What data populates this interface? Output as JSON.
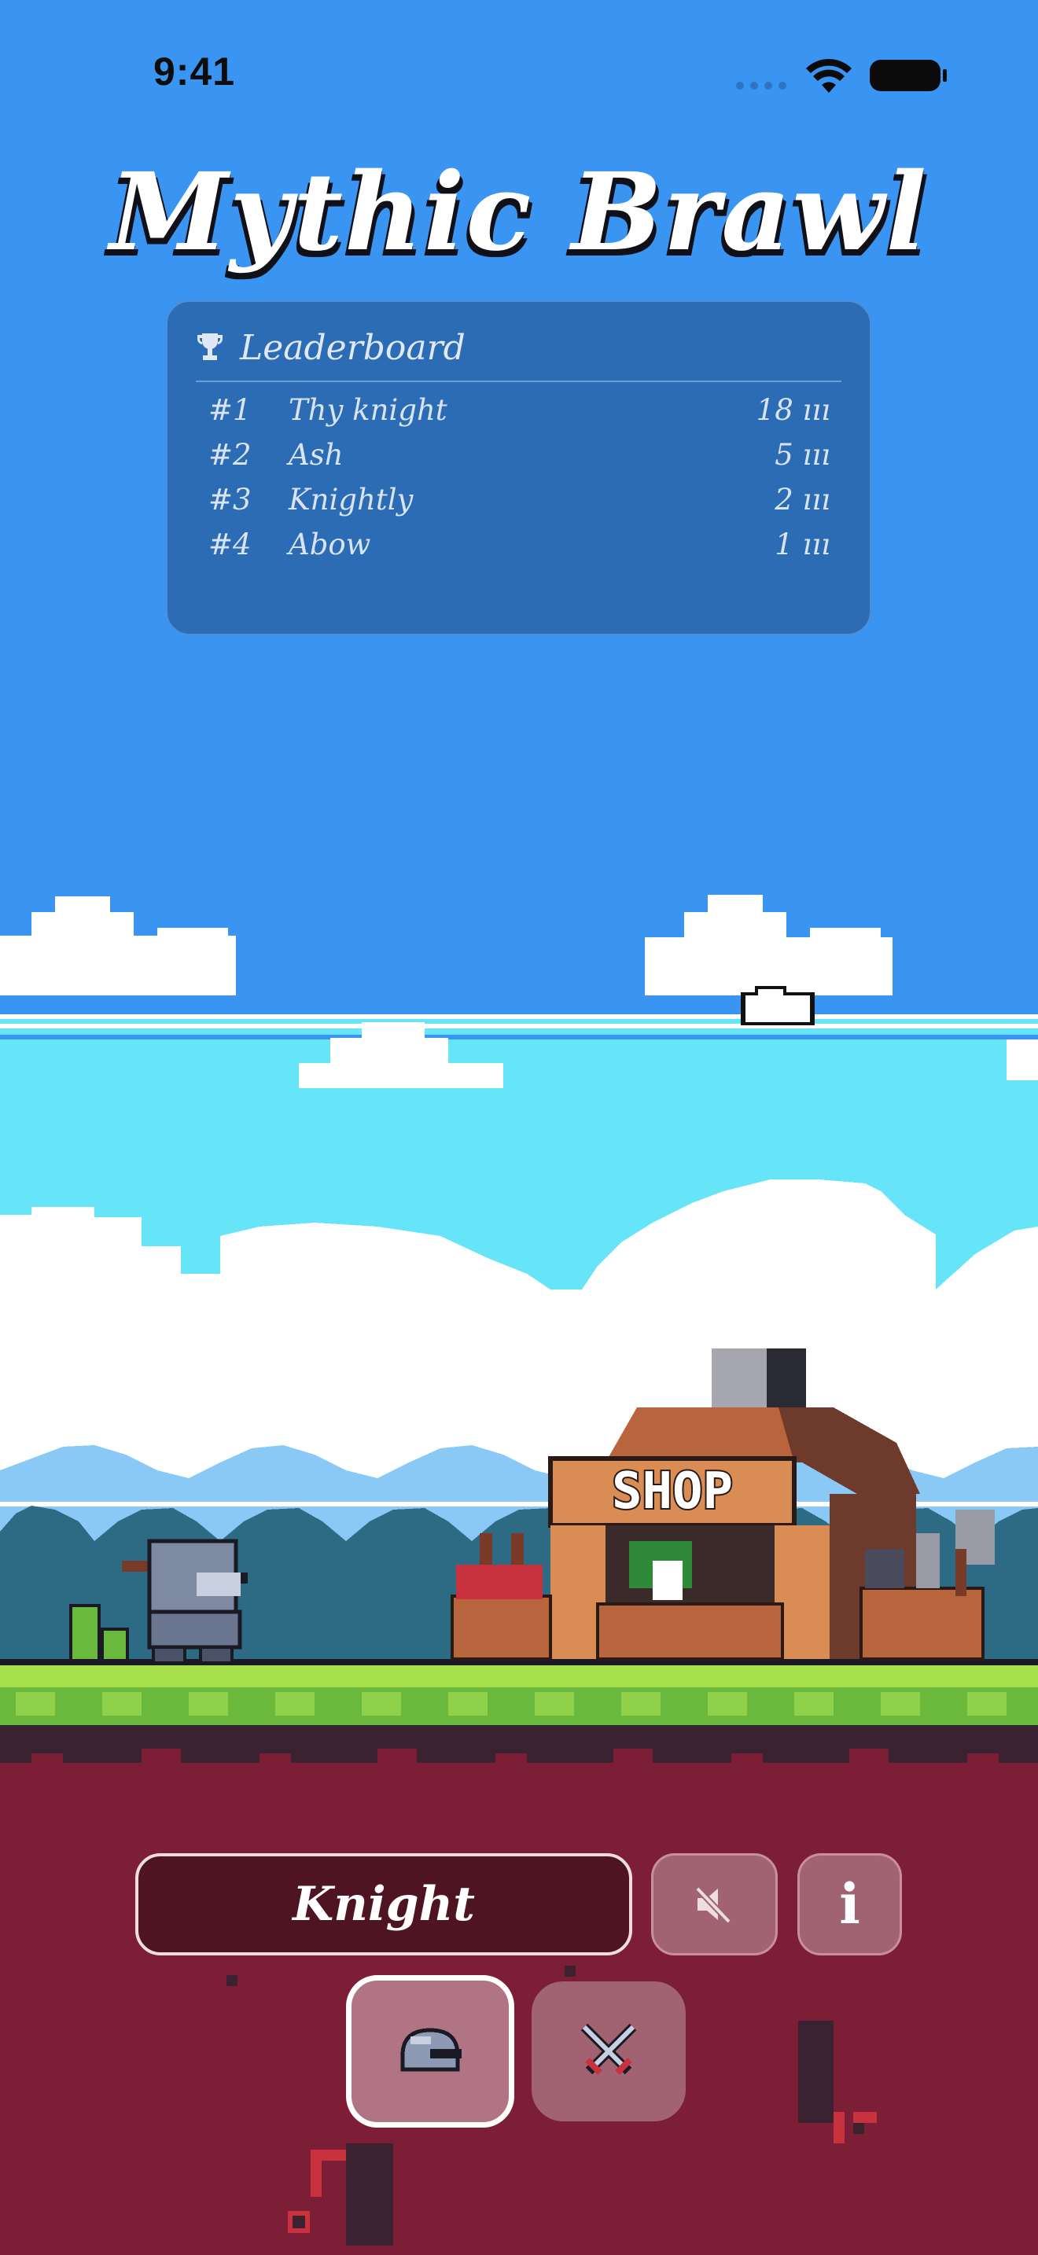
{
  "status_bar": {
    "time": "9:41"
  },
  "game": {
    "title": "Mythic Brawl"
  },
  "leaderboard": {
    "title": "Leaderboard",
    "entries": [
      {
        "rank": "#1",
        "name": "Thy knight",
        "score": "18 ııı"
      },
      {
        "rank": "#2",
        "name": "Ash",
        "score": "5 ııı"
      },
      {
        "rank": "#3",
        "name": "Knightly",
        "score": "2 ııı"
      },
      {
        "rank": "#4",
        "name": "Abow",
        "score": "1 ııı"
      }
    ]
  },
  "scene": {
    "shop_sign": "SHOP"
  },
  "controls": {
    "player_name": "Knight",
    "mute_icon": "speaker-muted-icon",
    "info_label": "i",
    "characters": [
      {
        "icon": "knight-helmet-icon",
        "selected": true
      },
      {
        "icon": "crossed-swords-icon",
        "selected": false
      }
    ]
  },
  "colors": {
    "sky": "#3a95f2",
    "ground": "#7b1e36",
    "grass": "#9be34a",
    "leaderboard_bg": "#2c6cb4",
    "button_bg": "#a16272",
    "name_pill_bg": "#4e1422"
  }
}
